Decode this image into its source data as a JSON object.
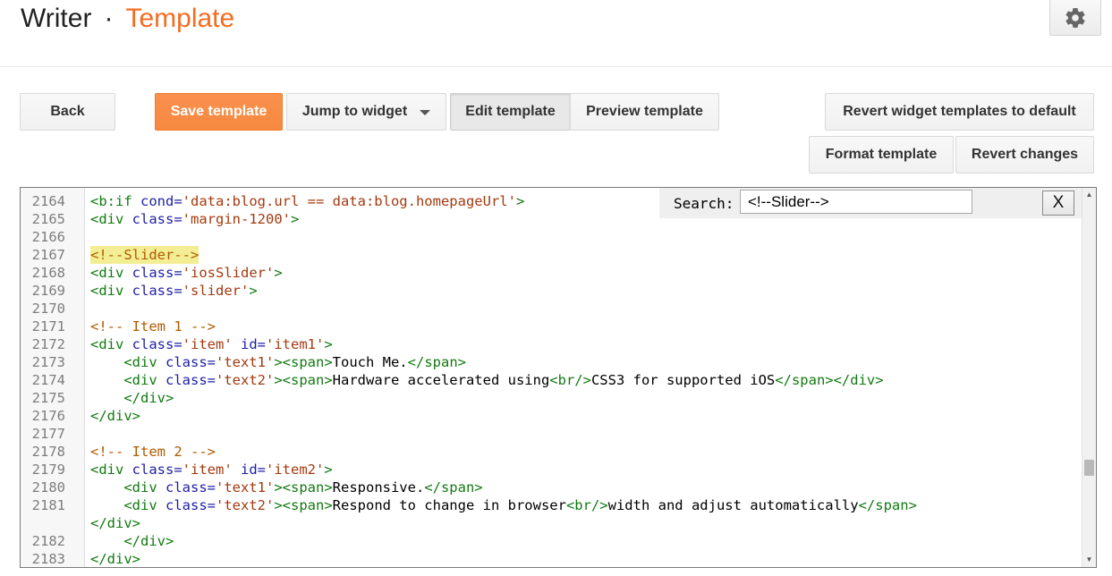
{
  "header": {
    "app_name": "Writer",
    "separator": "·",
    "page_name": "Template"
  },
  "toolbar": {
    "back": "Back",
    "save": "Save template",
    "jump": "Jump to widget",
    "edit": "Edit template",
    "preview": "Preview template",
    "revert_widgets": "Revert widget templates to default",
    "format": "Format template",
    "revert_changes": "Revert changes"
  },
  "search": {
    "label": "Search:",
    "value": "<!--Slider-->",
    "close": "X"
  },
  "scrollbar": {
    "up": "▲",
    "down": "▼"
  },
  "code_lines": [
    {
      "n": "2164",
      "indent": "",
      "tokens": [
        [
          "tag",
          "<b:if "
        ],
        [
          "attr",
          "cond="
        ],
        [
          "str",
          "'data:blog.url == data:blog.homepageUrl'"
        ],
        [
          "tag",
          ">"
        ]
      ]
    },
    {
      "n": "2165",
      "indent": "",
      "tokens": [
        [
          "tag",
          "<div "
        ],
        [
          "attr",
          "class="
        ],
        [
          "str",
          "'margin-1200'"
        ],
        [
          "tag",
          ">"
        ]
      ]
    },
    {
      "n": "2166",
      "indent": "",
      "tokens": []
    },
    {
      "n": "2167",
      "indent": "",
      "highlight": true,
      "tokens": [
        [
          "comment",
          "<!--Slider-->"
        ]
      ]
    },
    {
      "n": "2168",
      "indent": "",
      "tokens": [
        [
          "tag",
          "<div "
        ],
        [
          "attr",
          "class="
        ],
        [
          "str",
          "'iosSlider'"
        ],
        [
          "tag",
          ">"
        ]
      ]
    },
    {
      "n": "2169",
      "indent": "",
      "tokens": [
        [
          "tag",
          "<div "
        ],
        [
          "attr",
          "class="
        ],
        [
          "str",
          "'slider'"
        ],
        [
          "tag",
          ">"
        ]
      ]
    },
    {
      "n": "2170",
      "indent": "",
      "tokens": []
    },
    {
      "n": "2171",
      "indent": "",
      "tokens": [
        [
          "comment",
          "<!-- Item 1 -->"
        ]
      ]
    },
    {
      "n": "2172",
      "indent": "",
      "tokens": [
        [
          "tag",
          "<div "
        ],
        [
          "attr",
          "class="
        ],
        [
          "str",
          "'item' "
        ],
        [
          "attr",
          "id="
        ],
        [
          "str",
          "'item1'"
        ],
        [
          "tag",
          ">"
        ]
      ]
    },
    {
      "n": "2173",
      "indent": "    ",
      "tokens": [
        [
          "tag",
          "<div "
        ],
        [
          "attr",
          "class="
        ],
        [
          "str",
          "'text1'"
        ],
        [
          "tag",
          "><span>"
        ],
        [
          "text",
          "Touch Me."
        ],
        [
          "tag",
          "</span>"
        ]
      ]
    },
    {
      "n": "2174",
      "indent": "    ",
      "tokens": [
        [
          "tag",
          "<div "
        ],
        [
          "attr",
          "class="
        ],
        [
          "str",
          "'text2'"
        ],
        [
          "tag",
          "><span>"
        ],
        [
          "text",
          "Hardware accelerated using"
        ],
        [
          "tag",
          "<br/>"
        ],
        [
          "text",
          "CSS3 for supported iOS"
        ],
        [
          "tag",
          "</span></div>"
        ]
      ]
    },
    {
      "n": "2175",
      "indent": "    ",
      "tokens": [
        [
          "tag",
          "</div>"
        ]
      ]
    },
    {
      "n": "2176",
      "indent": "",
      "tokens": [
        [
          "tag",
          "</div>"
        ]
      ]
    },
    {
      "n": "2177",
      "indent": "",
      "tokens": []
    },
    {
      "n": "2178",
      "indent": "",
      "tokens": [
        [
          "comment",
          "<!-- Item 2 -->"
        ]
      ]
    },
    {
      "n": "2179",
      "indent": "",
      "tokens": [
        [
          "tag",
          "<div "
        ],
        [
          "attr",
          "class="
        ],
        [
          "str",
          "'item' "
        ],
        [
          "attr",
          "id="
        ],
        [
          "str",
          "'item2'"
        ],
        [
          "tag",
          ">"
        ]
      ]
    },
    {
      "n": "2180",
      "indent": "    ",
      "tokens": [
        [
          "tag",
          "<div "
        ],
        [
          "attr",
          "class="
        ],
        [
          "str",
          "'text1'"
        ],
        [
          "tag",
          "><span>"
        ],
        [
          "text",
          "Responsive."
        ],
        [
          "tag",
          "</span>"
        ]
      ]
    },
    {
      "n": "2181",
      "indent": "    ",
      "tokens": [
        [
          "tag",
          "<div "
        ],
        [
          "attr",
          "class="
        ],
        [
          "str",
          "'text2'"
        ],
        [
          "tag",
          "><span>"
        ],
        [
          "text",
          "Respond to change in browser"
        ],
        [
          "tag",
          "<br/>"
        ],
        [
          "text",
          "width and adjust automatically"
        ],
        [
          "tag",
          "</span>"
        ]
      ]
    },
    {
      "n": "",
      "indent": "",
      "tokens": [
        [
          "tag",
          "</div>"
        ]
      ]
    },
    {
      "n": "2182",
      "indent": "    ",
      "tokens": [
        [
          "tag",
          "</div>"
        ]
      ]
    },
    {
      "n": "2183",
      "indent": "",
      "tokens": [
        [
          "tag",
          "</div>"
        ]
      ]
    }
  ]
}
